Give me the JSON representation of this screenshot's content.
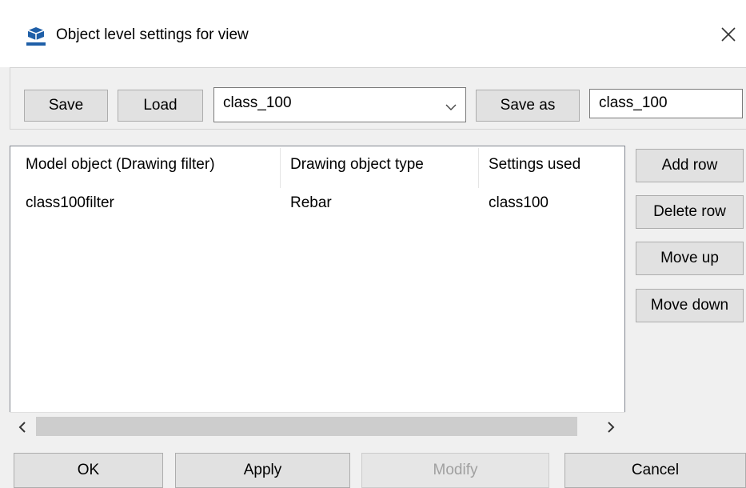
{
  "window": {
    "title": "Object level settings for view",
    "icon": "app-icon",
    "close": "close-icon"
  },
  "toolbar": {
    "save_label": "Save",
    "load_label": "Load",
    "selected_settings": "class_100",
    "save_as_label": "Save as",
    "save_as_name": "class_100"
  },
  "table": {
    "columns": [
      "Model object (Drawing filter)",
      "Drawing object type",
      "Settings used"
    ],
    "rows": [
      [
        "class100filter",
        "Rebar",
        "class100"
      ]
    ]
  },
  "side_buttons": {
    "add_row": "Add row",
    "delete_row": "Delete row",
    "move_up": "Move up",
    "move_down": "Move down"
  },
  "footer": {
    "ok": "OK",
    "apply": "Apply",
    "modify": "Modify",
    "cancel": "Cancel"
  },
  "colors": {
    "window_bg": "#f0f0f0",
    "button_bg": "#e1e1e1",
    "disabled_text": "#a0a0a0",
    "icon_blue": "#1f5fa8"
  }
}
